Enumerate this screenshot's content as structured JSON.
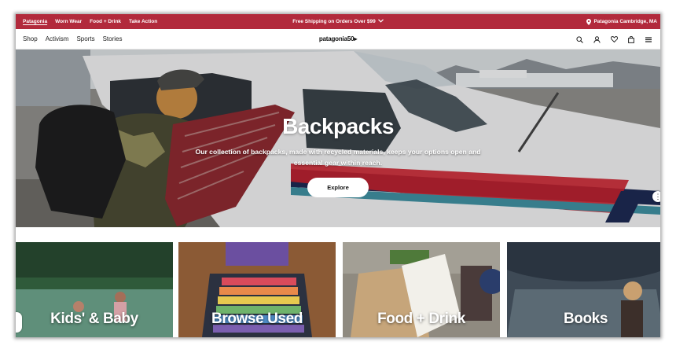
{
  "promo_bar": {
    "brand_tabs": [
      {
        "label": "Patagonia",
        "active": true
      },
      {
        "label": "Worn Wear",
        "active": false
      },
      {
        "label": "Food + Drink",
        "active": false
      },
      {
        "label": "Take Action",
        "active": false
      }
    ],
    "promo_text": "Free Shipping on Orders Over $99",
    "store_label": "Patagonia Cambridge, MA"
  },
  "main_nav": {
    "links": [
      "Shop",
      "Activism",
      "Sports",
      "Stories"
    ],
    "logo": "patagonia50▸",
    "icons": [
      "search-icon",
      "account-icon",
      "wishlist-heart-icon",
      "cart-bag-icon",
      "menu-icon"
    ]
  },
  "hero": {
    "title": "Backpacks",
    "description": "Our collection of backpacks, made with recycled materials, keeps your options open and essential gear within reach.",
    "button_label": "Explore"
  },
  "categories": [
    {
      "label": "Kids' & Baby"
    },
    {
      "label": "Browse Used"
    },
    {
      "label": "Food + Drink"
    },
    {
      "label": "Books"
    }
  ],
  "colors": {
    "promo_bar": "#b22a3c",
    "accent_red": "#c8202c",
    "navy": "#1d2a52",
    "teal": "#3f8fa0"
  }
}
